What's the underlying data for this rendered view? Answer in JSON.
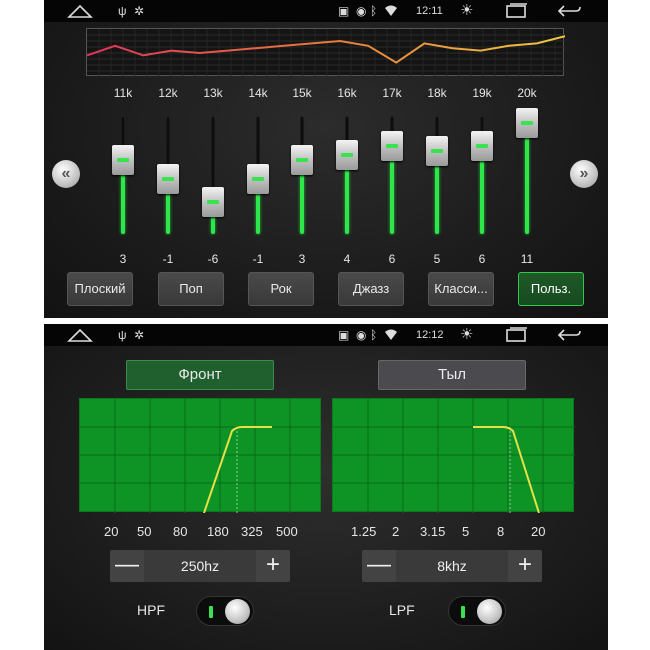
{
  "top_status": {
    "time": "12:11"
  },
  "bottom_status": {
    "time": "12:12"
  },
  "status_icons": [
    "home-icon",
    "usb-icon",
    "settings-cog-icon",
    "cast-icon",
    "location-icon",
    "bluetooth-icon",
    "wifi-icon",
    "brightness-icon",
    "recent-apps-icon",
    "back-icon"
  ],
  "equalizer": {
    "bands": [
      {
        "freq": "11k",
        "gain": "3",
        "value": 3
      },
      {
        "freq": "12k",
        "gain": "-1",
        "value": -1
      },
      {
        "freq": "13k",
        "gain": "-6",
        "value": -6
      },
      {
        "freq": "14k",
        "gain": "-1",
        "value": -1
      },
      {
        "freq": "15k",
        "gain": "3",
        "value": 3
      },
      {
        "freq": "16k",
        "gain": "4",
        "value": 4
      },
      {
        "freq": "17k",
        "gain": "6",
        "value": 6
      },
      {
        "freq": "18k",
        "gain": "5",
        "value": 5
      },
      {
        "freq": "19k",
        "gain": "6",
        "value": 6
      },
      {
        "freq": "20k",
        "gain": "11",
        "value": 11
      }
    ],
    "gain_range": [
      -12,
      12
    ],
    "curve": [
      0.55,
      0.35,
      0.55,
      0.45,
      0.5,
      0.45,
      0.4,
      0.35,
      0.3,
      0.25,
      0.35,
      0.7,
      0.3,
      0.4,
      0.45,
      0.35,
      0.3,
      0.15
    ],
    "prev_arrow": "«",
    "next_arrow": "»",
    "presets": [
      "Плоский",
      "Поп",
      "Рок",
      "Джазз",
      "Класси...",
      "Польз."
    ],
    "active_preset": "Польз."
  },
  "crossover": {
    "front_tab": "Фронт",
    "rear_tab": "Тыл",
    "active_tab": "Фронт",
    "hpf_ticks": [
      "20",
      "50",
      "80",
      "180",
      "325",
      "500"
    ],
    "lpf_ticks": [
      "1.25",
      "2",
      "3.15",
      "5",
      "8",
      "20"
    ],
    "hpf": {
      "minus": "—",
      "value": "250hz",
      "plus": "+",
      "label": "HPF",
      "enabled": true
    },
    "lpf": {
      "minus": "—",
      "value": "8khz",
      "plus": "+",
      "label": "LPF",
      "enabled": true
    }
  },
  "colors": {
    "accent_green": "#2ee64a",
    "graph_green": "#0d9424",
    "curve_yellow": "#e8e04a"
  }
}
